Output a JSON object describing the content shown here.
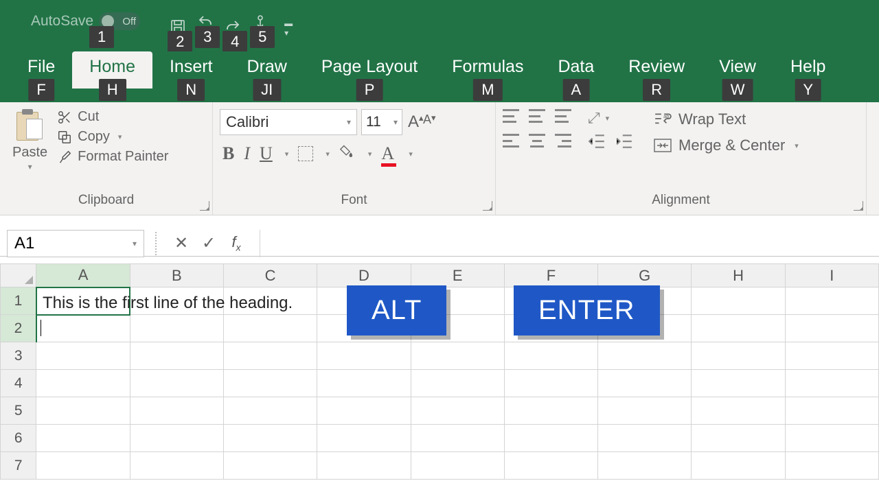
{
  "titlebar": {
    "autosave_label": "AutoSave",
    "autosave_state": "Off",
    "qat_keytips": [
      "1",
      "2",
      "3",
      "4",
      "5"
    ],
    "more_commands": "⌄"
  },
  "tabs": [
    {
      "label": "File",
      "keytip": "F",
      "active": false
    },
    {
      "label": "Home",
      "keytip": "H",
      "active": true
    },
    {
      "label": "Insert",
      "keytip": "N",
      "active": false
    },
    {
      "label": "Draw",
      "keytip": "JI",
      "active": false
    },
    {
      "label": "Page Layout",
      "keytip": "P",
      "active": false
    },
    {
      "label": "Formulas",
      "keytip": "M",
      "active": false
    },
    {
      "label": "Data",
      "keytip": "A",
      "active": false
    },
    {
      "label": "Review",
      "keytip": "R",
      "active": false
    },
    {
      "label": "View",
      "keytip": "W",
      "active": false
    },
    {
      "label": "Help",
      "keytip": "Y",
      "active": false
    }
  ],
  "ribbon": {
    "clipboard": {
      "group_label": "Clipboard",
      "paste": "Paste",
      "cut": "Cut",
      "copy": "Copy",
      "format_painter": "Format Painter"
    },
    "font": {
      "group_label": "Font",
      "font_name": "Calibri",
      "font_size": "11",
      "bold": "B",
      "italic": "I",
      "underline": "U",
      "increase_A": "A",
      "decrease_A": "A",
      "font_color_A": "A"
    },
    "alignment": {
      "group_label": "Alignment",
      "wrap_text": "Wrap Text",
      "merge_center": "Merge & Center"
    }
  },
  "formulabar": {
    "name_box": "A1",
    "cancel": "✕",
    "enter": "✓",
    "fx": "fx",
    "formula_text": ""
  },
  "grid": {
    "columns": [
      "A",
      "B",
      "C",
      "D",
      "E",
      "F",
      "G",
      "H",
      "I"
    ],
    "rows": [
      "1",
      "2",
      "3",
      "4",
      "5",
      "6",
      "7"
    ],
    "a1_text": "This is the first line of the heading.",
    "selected_cell": "A1"
  },
  "overlay": {
    "key1": "ALT",
    "key2": "ENTER"
  }
}
